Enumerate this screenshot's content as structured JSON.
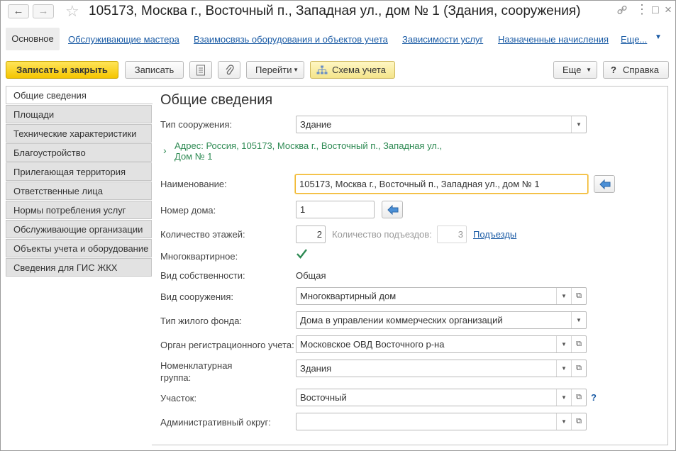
{
  "window": {
    "title": "105173, Москва г., Восточный п., Западная ул., дом № 1 (Здания, сооружения)",
    "back_icon": "arrow-left-icon",
    "forward_icon": "arrow-right-icon"
  },
  "tabs": {
    "active": "Основное",
    "links": [
      "Обслуживающие мастера",
      "Взаимосвязь оборудования и объектов учета",
      "Зависимости услуг",
      "Назначенные начисления",
      "Еще..."
    ]
  },
  "toolbar": {
    "save_close": "Записать и закрыть",
    "save": "Записать",
    "goto": "Перейти",
    "scheme": "Схема учета",
    "more": "Еще",
    "help": "Справка"
  },
  "sidebar": {
    "items": [
      "Общие сведения",
      "Площади",
      "Технические характеристики",
      "Благоустройство",
      "Прилегающая территория",
      "Ответственные лица",
      "Нормы потребления услуг",
      "Обслуживающие организации",
      "Объекты учета и оборудование",
      "Сведения для ГИС ЖКХ"
    ]
  },
  "form": {
    "heading": "Общие сведения",
    "building_type_label": "Тип сооружения:",
    "building_type_value": "Здание",
    "address_line1": "Адрес: Россия, 105173, Москва г., Восточный п., Западная ул.,",
    "address_line2": "Дом № 1",
    "name_label": "Наименование:",
    "name_value": "105173, Москва г., Восточный п., Западная ул., дом № 1",
    "house_number_label": "Номер дома:",
    "house_number_value": "1",
    "floors_label": "Количество этажей:",
    "floors_value": "2",
    "entrances_label": "Количество подъездов:",
    "entrances_value": "3",
    "entrances_link": "Подъезды",
    "apartment_label": "Многоквартирное:",
    "apartment_checked": true,
    "ownership_label": "Вид собственности:",
    "ownership_value": "Общая",
    "structure_kind_label": "Вид сооружения:",
    "structure_kind_value": "Многоквартирный дом",
    "housing_fund_label": "Тип жилого фонда:",
    "housing_fund_value": "Дома в управлении коммерческих организаций",
    "registration_label": "Орган регистрационного учета:",
    "registration_value": "Московское ОВД Восточного р-на",
    "nomenclature_label_1": "Номенклатурная",
    "nomenclature_label_2": "группа:",
    "nomenclature_value": "Здания",
    "area_label": "Участок:",
    "area_value": "Восточный",
    "district_label": "Административный округ:",
    "district_value": ""
  }
}
